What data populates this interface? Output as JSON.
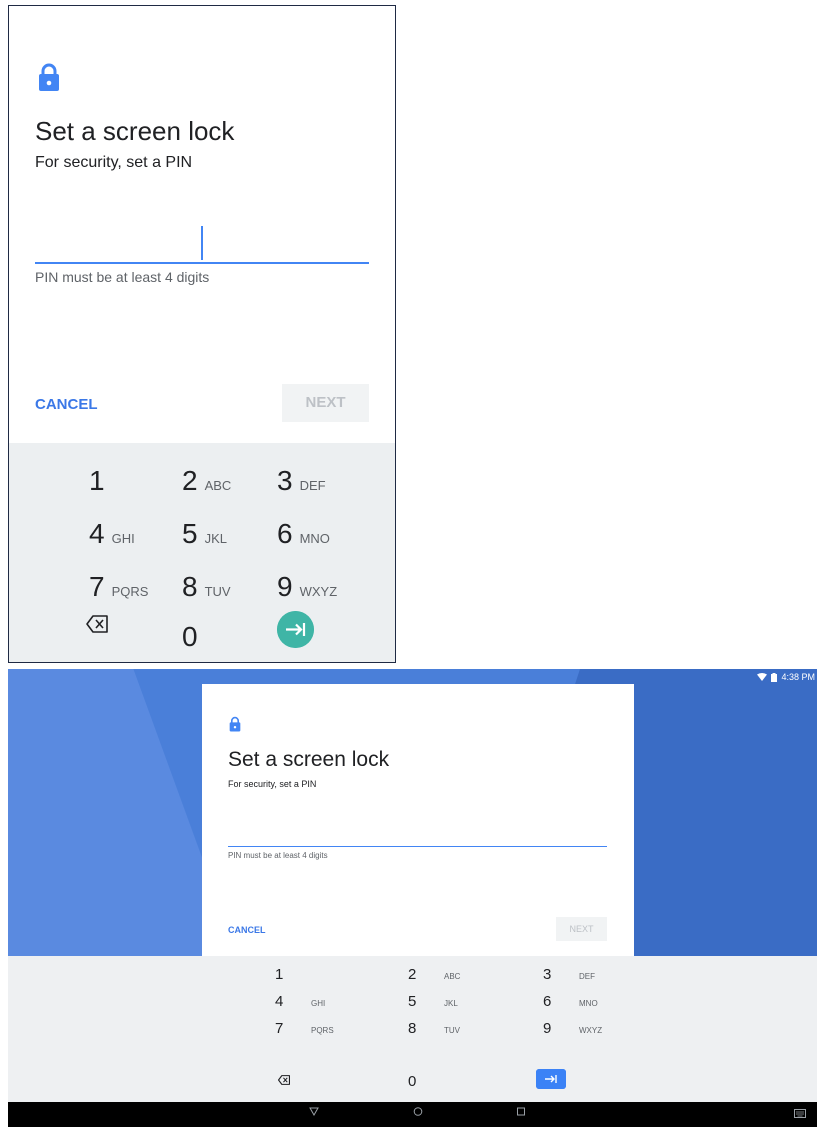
{
  "dialog": {
    "title": "Set a screen lock",
    "subtitle": "For security, set a PIN",
    "pin_value": "",
    "pin_hint": "PIN must be at least 4 digits",
    "cancel_label": "CANCEL",
    "next_label": "NEXT"
  },
  "keypad": {
    "keys": [
      {
        "num": "1",
        "letters": ""
      },
      {
        "num": "2",
        "letters": "ABC"
      },
      {
        "num": "3",
        "letters": "DEF"
      },
      {
        "num": "4",
        "letters": "GHI"
      },
      {
        "num": "5",
        "letters": "JKL"
      },
      {
        "num": "6",
        "letters": "MNO"
      },
      {
        "num": "7",
        "letters": "PQRS"
      },
      {
        "num": "8",
        "letters": "TUV"
      },
      {
        "num": "9",
        "letters": "WXYZ"
      },
      {
        "num": "0",
        "letters": ""
      }
    ],
    "delete_icon": "backspace-icon",
    "enter_icon": "tab-enter-icon"
  },
  "status_bar": {
    "time": "4:38 PM",
    "icons": [
      "wifi-icon",
      "battery-icon"
    ]
  },
  "nav_bar": {
    "icons": [
      "back-icon",
      "home-icon",
      "recents-icon",
      "keyboard-icon"
    ]
  },
  "colors": {
    "accent": "#4285f4",
    "enter_key_zoom": "#3fb5a6",
    "enter_key_tablet": "#3b82f6",
    "wallpaper": "#4a7fd9"
  }
}
